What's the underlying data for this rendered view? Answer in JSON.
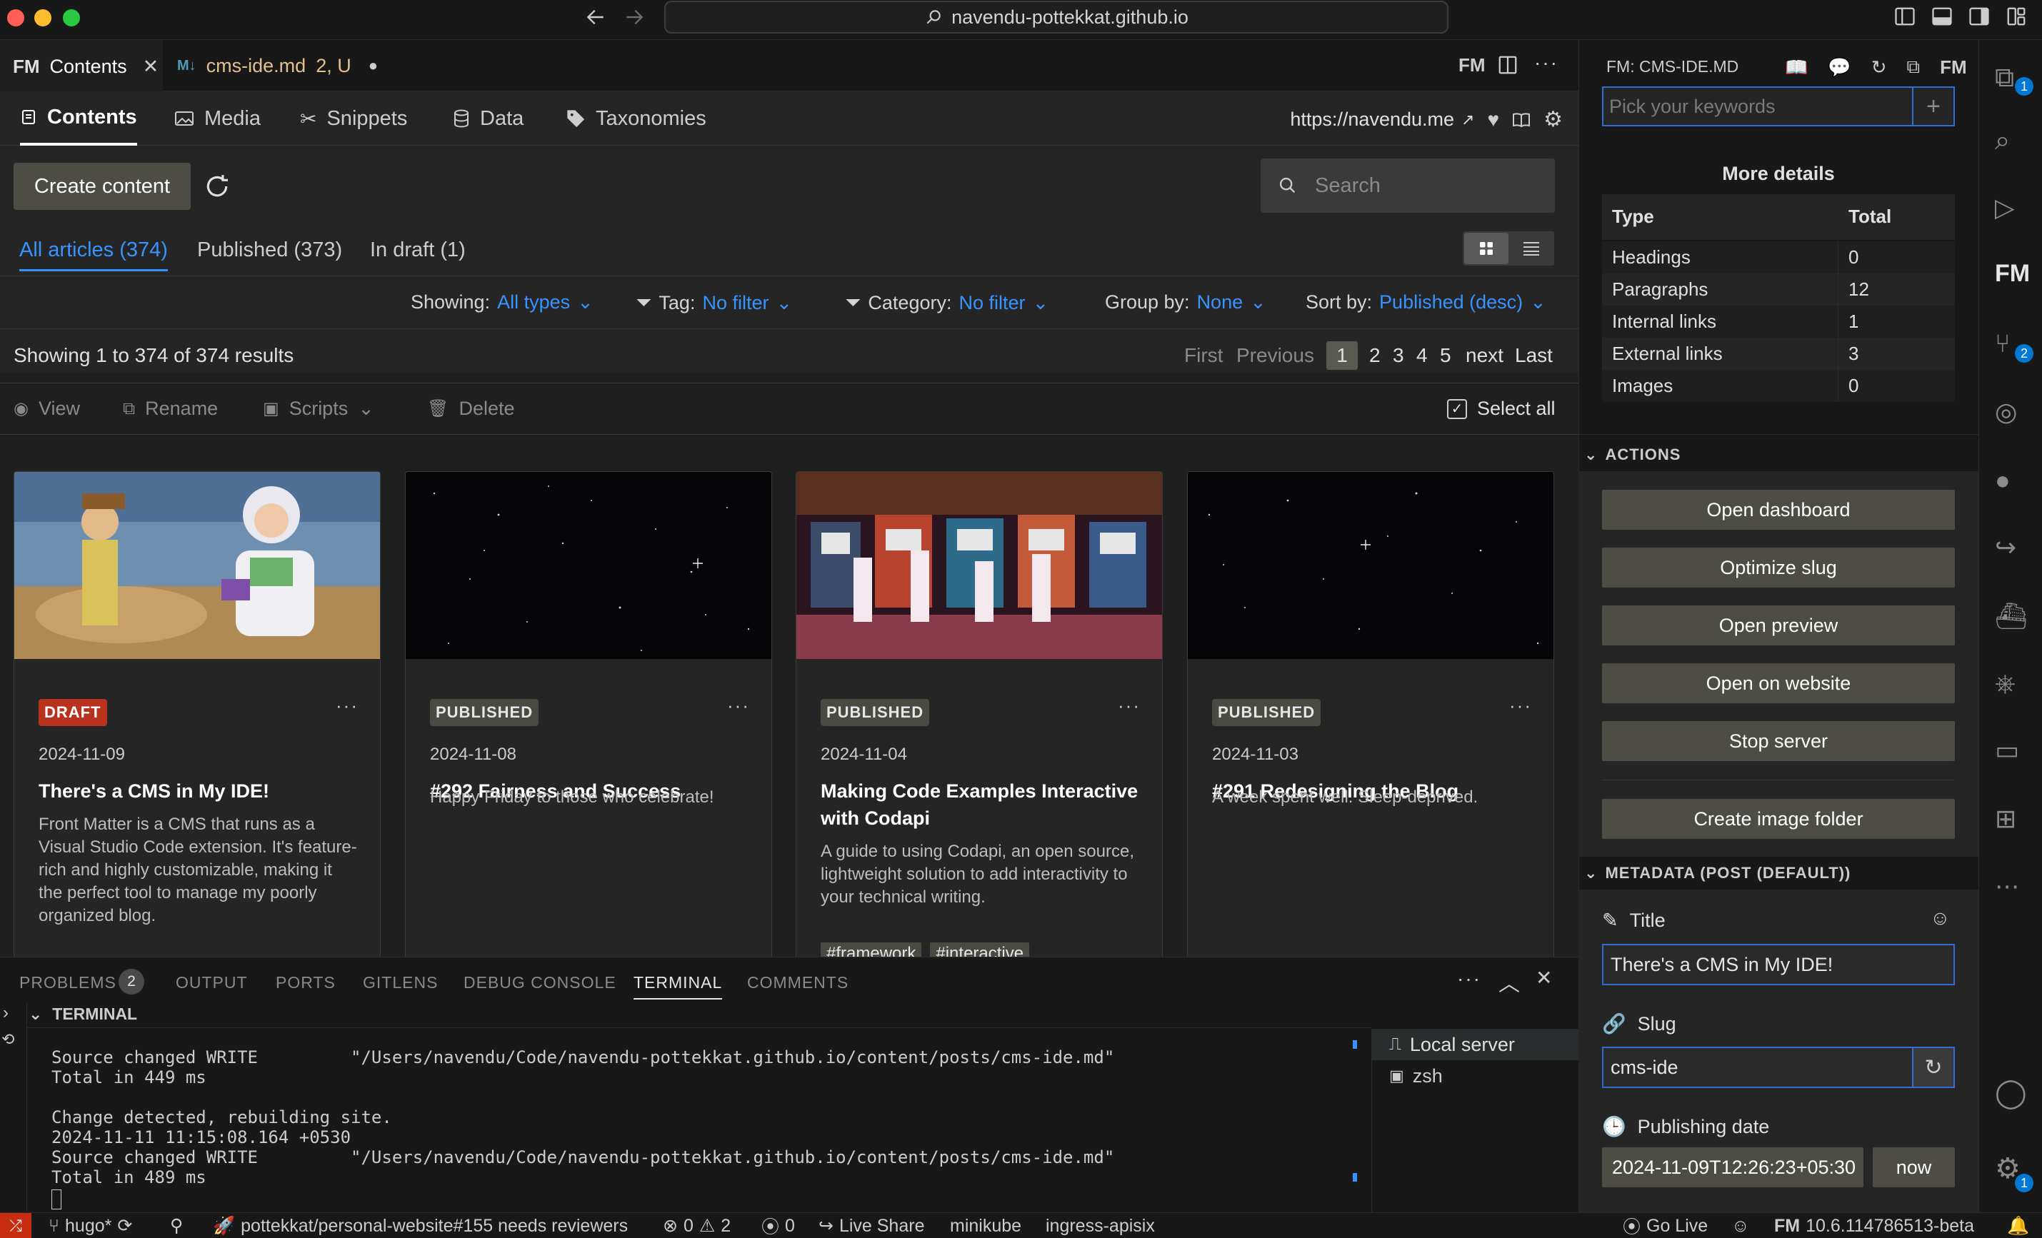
{
  "window": {
    "url": "navendu-pottekkat.github.io"
  },
  "editor_tabs": [
    {
      "label": "Contents"
    },
    {
      "label": "cms-ide.md",
      "status": "2, U"
    }
  ],
  "fm_nav": {
    "tabs": [
      {
        "label": "Contents"
      },
      {
        "label": "Media"
      },
      {
        "label": "Snippets"
      },
      {
        "label": "Data"
      },
      {
        "label": "Taxonomies"
      }
    ],
    "site_url": "https://navendu.me"
  },
  "toolbar": {
    "create_label": "Create content",
    "search_placeholder": "Search"
  },
  "filter_tabs": [
    {
      "label": "All articles (374)"
    },
    {
      "label": "Published (373)"
    },
    {
      "label": "In draft (1)"
    }
  ],
  "filters": {
    "showing_label": "Showing:",
    "showing_value": "All types",
    "tag_label": "Tag:",
    "tag_value": "No filter",
    "category_label": "Category:",
    "category_value": "No filter",
    "group_label": "Group by:",
    "group_value": "None",
    "sort_label": "Sort by:",
    "sort_value": "Published (desc)"
  },
  "results": {
    "summary": "Showing 1 to 374 of 374 results",
    "first": "First",
    "previous": "Previous",
    "pages": [
      "1",
      "2",
      "3",
      "4",
      "5"
    ],
    "next": "next",
    "last": "Last"
  },
  "actions_row": {
    "view": "View",
    "rename": "Rename",
    "scripts": "Scripts",
    "delete": "Delete",
    "select_all": "Select all"
  },
  "cards": [
    {
      "status": "DRAFT",
      "date": "2024-11-09",
      "title": "There's a CMS in My IDE!",
      "description": "Front Matter is a CMS that runs as a Visual Studio Code extension. It's feature-rich and highly customizable, making it the perfect tool to manage my poorly organized blog.",
      "tags": []
    },
    {
      "status": "PUBLISHED",
      "date": "2024-11-08",
      "title": "#292 Fairness and Success",
      "description": "Happy Friday to those who celebrate!",
      "tags": []
    },
    {
      "status": "PUBLISHED",
      "date": "2024-11-04",
      "title": "Making Code Examples Interactive with Codapi",
      "description": "A guide to using Codapi, an open source, lightweight solution to add interactivity to your technical writing.",
      "tags": [
        "#framework",
        "#interactive"
      ]
    },
    {
      "status": "PUBLISHED",
      "date": "2024-11-03",
      "title": "#291 Redesigning the Blog",
      "description": "A week spent well. Sleep-deprived.",
      "tags": []
    }
  ],
  "panel": {
    "tabs": [
      "PROBLEMS",
      "OUTPUT",
      "PORTS",
      "GITLENS",
      "DEBUG CONSOLE",
      "TERMINAL",
      "COMMENTS"
    ],
    "problems_count": "2",
    "terminal_title": "TERMINAL",
    "terminal_lines": [
      "Source changed WRITE         \"/Users/navendu/Code/navendu-pottekkat.github.io/content/posts/cms-ide.md\"",
      "Total in 449 ms",
      "",
      "Change detected, rebuilding site.",
      "2024-11-11 11:15:08.164 +0530",
      "Source changed WRITE         \"/Users/navendu/Code/navendu-pottekkat.github.io/content/posts/cms-ide.md\"",
      "Total in 489 ms"
    ],
    "terminals": [
      "Local server",
      "zsh"
    ]
  },
  "sidebar": {
    "title": "FM: CMS-IDE.MD",
    "keywords_placeholder": "Pick your keywords",
    "more_details": "More details",
    "details_header": [
      "Type",
      "Total"
    ],
    "details_rows": [
      {
        "type": "Headings",
        "total": "0"
      },
      {
        "type": "Paragraphs",
        "total": "12"
      },
      {
        "type": "Internal links",
        "total": "1"
      },
      {
        "type": "External links",
        "total": "3"
      },
      {
        "type": "Images",
        "total": "0"
      }
    ],
    "actions_title": "ACTIONS",
    "actions": [
      "Open dashboard",
      "Optimize slug",
      "Open preview",
      "Open on website",
      "Stop server",
      "Create image folder"
    ],
    "metadata_title": "METADATA (POST (DEFAULT))",
    "title_label": "Title",
    "title_value": "There's a CMS in My IDE!",
    "slug_label": "Slug",
    "slug_value": "cms-ide",
    "date_label": "Publishing date",
    "date_value": "2024-11-09T12:26:23+05:30",
    "now_label": "now"
  },
  "activity_badges": {
    "explorer": "1",
    "source_control": "2",
    "settings": "1"
  },
  "statusbar": {
    "branch": "hugo*",
    "pr": "pottekkat/personal-website#155 needs reviewers",
    "errors": "0",
    "warnings": "2",
    "ports": "0",
    "live_share": "Live Share",
    "k8s_context": "minikube",
    "k8s_ns": "ingress-apisix",
    "go_live": "Go Live",
    "fm_version": "10.6.114786513-beta"
  },
  "colors": {
    "accent": "#3794ff",
    "draft": "#b8321e",
    "button": "#4d4d46"
  }
}
